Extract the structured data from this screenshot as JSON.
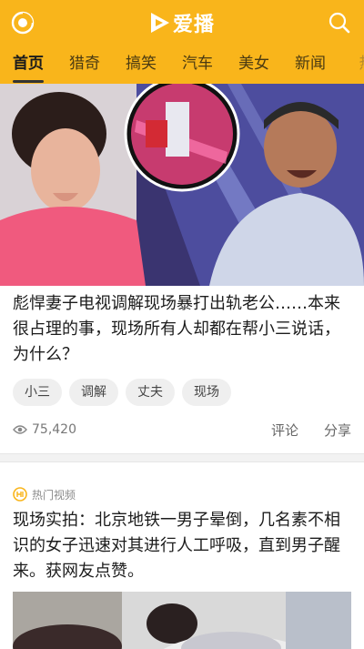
{
  "header": {
    "brand_name": "爱播",
    "accent_color": "#f9b51b",
    "left_icon": "app-logo-icon",
    "right_icon": "search-icon"
  },
  "tabs": [
    {
      "label": "首页",
      "active": true
    },
    {
      "label": "猎奇"
    },
    {
      "label": "搞笑"
    },
    {
      "label": "汽车"
    },
    {
      "label": "美女"
    },
    {
      "label": "新闻"
    },
    {
      "label": "热"
    }
  ],
  "cards": [
    {
      "title": "彪悍妻子电视调解现场暴打出轨老公……本来很占理的事，现场所有人却都在帮小三说话，为什么？",
      "tags": [
        "小三",
        "调解",
        "丈夫",
        "现场"
      ],
      "views": "75,420",
      "comment_label": "评论",
      "share_label": "分享"
    },
    {
      "source": "热门视频",
      "title": "现场实拍：北京地铁一男子晕倒，几名素不相识的女子迅速对其进行人工呼吸，直到男子醒来。获网友点赞。"
    }
  ]
}
